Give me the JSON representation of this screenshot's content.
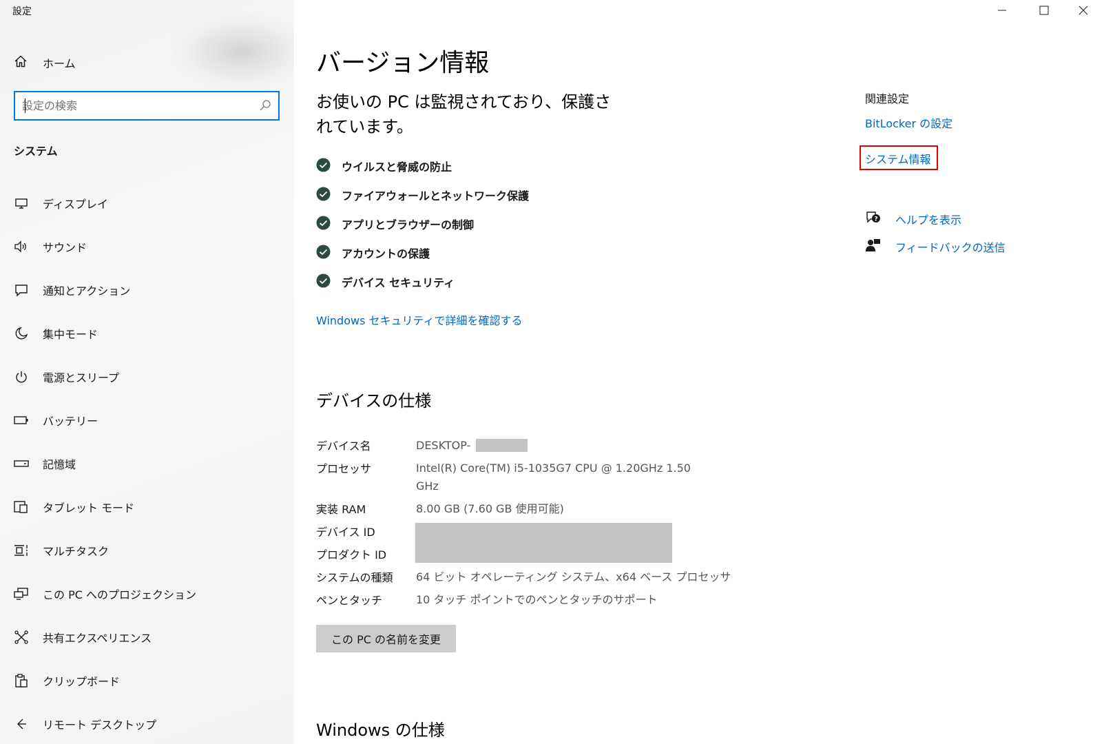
{
  "window": {
    "title": "設定",
    "controls": [
      "minimize-icon",
      "maximize-icon",
      "close-icon"
    ]
  },
  "sidebar": {
    "home_label": "ホーム",
    "search_placeholder": "設定の検索",
    "section_title": "システム",
    "items": [
      {
        "label": "ディスプレイ",
        "icon": "display-icon"
      },
      {
        "label": "サウンド",
        "icon": "speaker-icon"
      },
      {
        "label": "通知とアクション",
        "icon": "notification-icon"
      },
      {
        "label": "集中モード",
        "icon": "moon-icon"
      },
      {
        "label": "電源とスリープ",
        "icon": "power-icon"
      },
      {
        "label": "バッテリー",
        "icon": "battery-icon"
      },
      {
        "label": "記憶域",
        "icon": "storage-icon"
      },
      {
        "label": "タブレット モード",
        "icon": "tablet-mode-icon"
      },
      {
        "label": "マルチタスク",
        "icon": "multitask-icon"
      },
      {
        "label": "この PC へのプロジェクション",
        "icon": "projection-icon"
      },
      {
        "label": "共有エクスペリエンス",
        "icon": "shared-experience-icon"
      },
      {
        "label": "クリップボード",
        "icon": "clipboard-icon"
      },
      {
        "label": "リモート デスクトップ",
        "icon": "remote-desktop-icon"
      }
    ]
  },
  "main": {
    "title": "バージョン情報",
    "status_heading": "お使いの PC は監視されており、保護されています。",
    "protections": [
      "ウイルスと脅威の防止",
      "ファイアウォールとネットワーク保護",
      "アプリとブラウザーの制御",
      "アカウントの保護",
      "デバイス セキュリティ"
    ],
    "security_link": "Windows セキュリティで詳細を確認する",
    "device_specs_heading": "デバイスの仕様",
    "specs": {
      "device_name": {
        "label": "デバイス名",
        "value": "DESKTOP-"
      },
      "processor": {
        "label": "プロセッサ",
        "value": "Intel(R) Core(TM) i5-1035G7 CPU @ 1.20GHz   1.50 GHz"
      },
      "ram": {
        "label": "実装 RAM",
        "value": "8.00 GB (7.60 GB 使用可能)"
      },
      "device_id": {
        "label": "デバイス ID",
        "value": ""
      },
      "product_id": {
        "label": "プロダクト ID",
        "value": ""
      },
      "system_type": {
        "label": "システムの種類",
        "value": "64 ビット オペレーティング システム、x64 ベース プロセッサ"
      },
      "pen_touch": {
        "label": "ペンとタッチ",
        "value": "10 タッチ ポイントでのペンとタッチのサポート"
      }
    },
    "rename_button": "この PC の名前を変更",
    "windows_specs_heading": "Windows の仕様"
  },
  "related": {
    "heading": "関連設定",
    "bitlocker_link": "BitLocker の設定",
    "system_info_link": "システム情報",
    "help_link": "ヘルプを表示",
    "feedback_link": "フィードバックの送信"
  },
  "colors": {
    "accent": "#0078d7",
    "link": "#0067c0",
    "highlight": "#e00000",
    "check": "#2d4a3e"
  }
}
